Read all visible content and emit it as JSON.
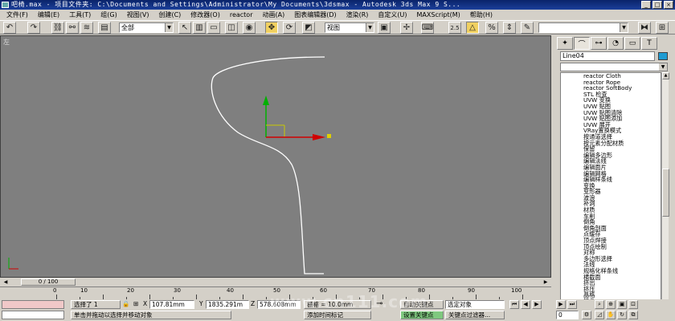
{
  "titlebar": {
    "title": "吧椅.max  - 项目文件夹: C:\\Documents and Settings\\Administrator\\My Documents\\3dsmax  - Autodesk 3ds Max 9 S..."
  },
  "menu": [
    "文件(F)",
    "编辑(E)",
    "工具(T)",
    "组(G)",
    "视图(V)",
    "创建(C)",
    "修改器(O)",
    "reactor",
    "动画(A)",
    "图表编辑器(D)",
    "渲染(R)",
    "自定义(U)",
    "MAXScript(M)",
    "帮助(H)"
  ],
  "toolbar": {
    "selection_filter": "全部",
    "ref_coord": "视图",
    "snap_value": "2.5",
    "named_selection": ""
  },
  "viewport": {
    "label": "左"
  },
  "command_panel": {
    "object_name": "Line04",
    "object_color": "#1e9bd2",
    "modifier_list_items": [
      "reactor Cloth",
      "reactor Rope",
      "reactor SoftBody",
      "STL 检查",
      "UVW 变换",
      "UVW 贴图",
      "UVW 贴图清除",
      "UVW 贴图添加",
      "UVW 展开",
      "VRay置换模式",
      "按通道选择",
      "按元素分配材质",
      "保留",
      "编辑多边形",
      "编辑法线",
      "编辑面片",
      "编辑网格",
      "编辑样条线",
      "变换",
      "变形器",
      "波浪",
      "补洞",
      "材质",
      "车削",
      "倒角",
      "倒角剖面",
      "点缓存",
      "顶点焊接",
      "顶点绘制",
      "对称",
      "多边形选择",
      "法线",
      "规格化样条线",
      "横截面",
      "挤出",
      "挤压",
      "晶格",
      "镜像",
      "壳"
    ]
  },
  "time": {
    "slider_label": "0 / 100",
    "ticks": [
      "0",
      "10",
      "20",
      "30",
      "40",
      "50",
      "60",
      "70",
      "80",
      "90",
      "100"
    ]
  },
  "status": {
    "selected": "选择了 1",
    "x_label": "X",
    "x_value": "107.81mm",
    "y_label": "Y",
    "y_value": "1835.291m",
    "z_label": "Z",
    "z_value": "578.608mm",
    "grid_label": "栅格 = 10.0mm",
    "auto_key": "自动关键点",
    "set_key": "设置关键点",
    "selected_object": "选定对象",
    "key_filters": "关键点过滤器...",
    "prompt": "单击并拖动以选择并移动对象",
    "add_time_tag": "添加时间标记",
    "frame_value": "0"
  },
  "watermark": "www.cn111.com"
}
